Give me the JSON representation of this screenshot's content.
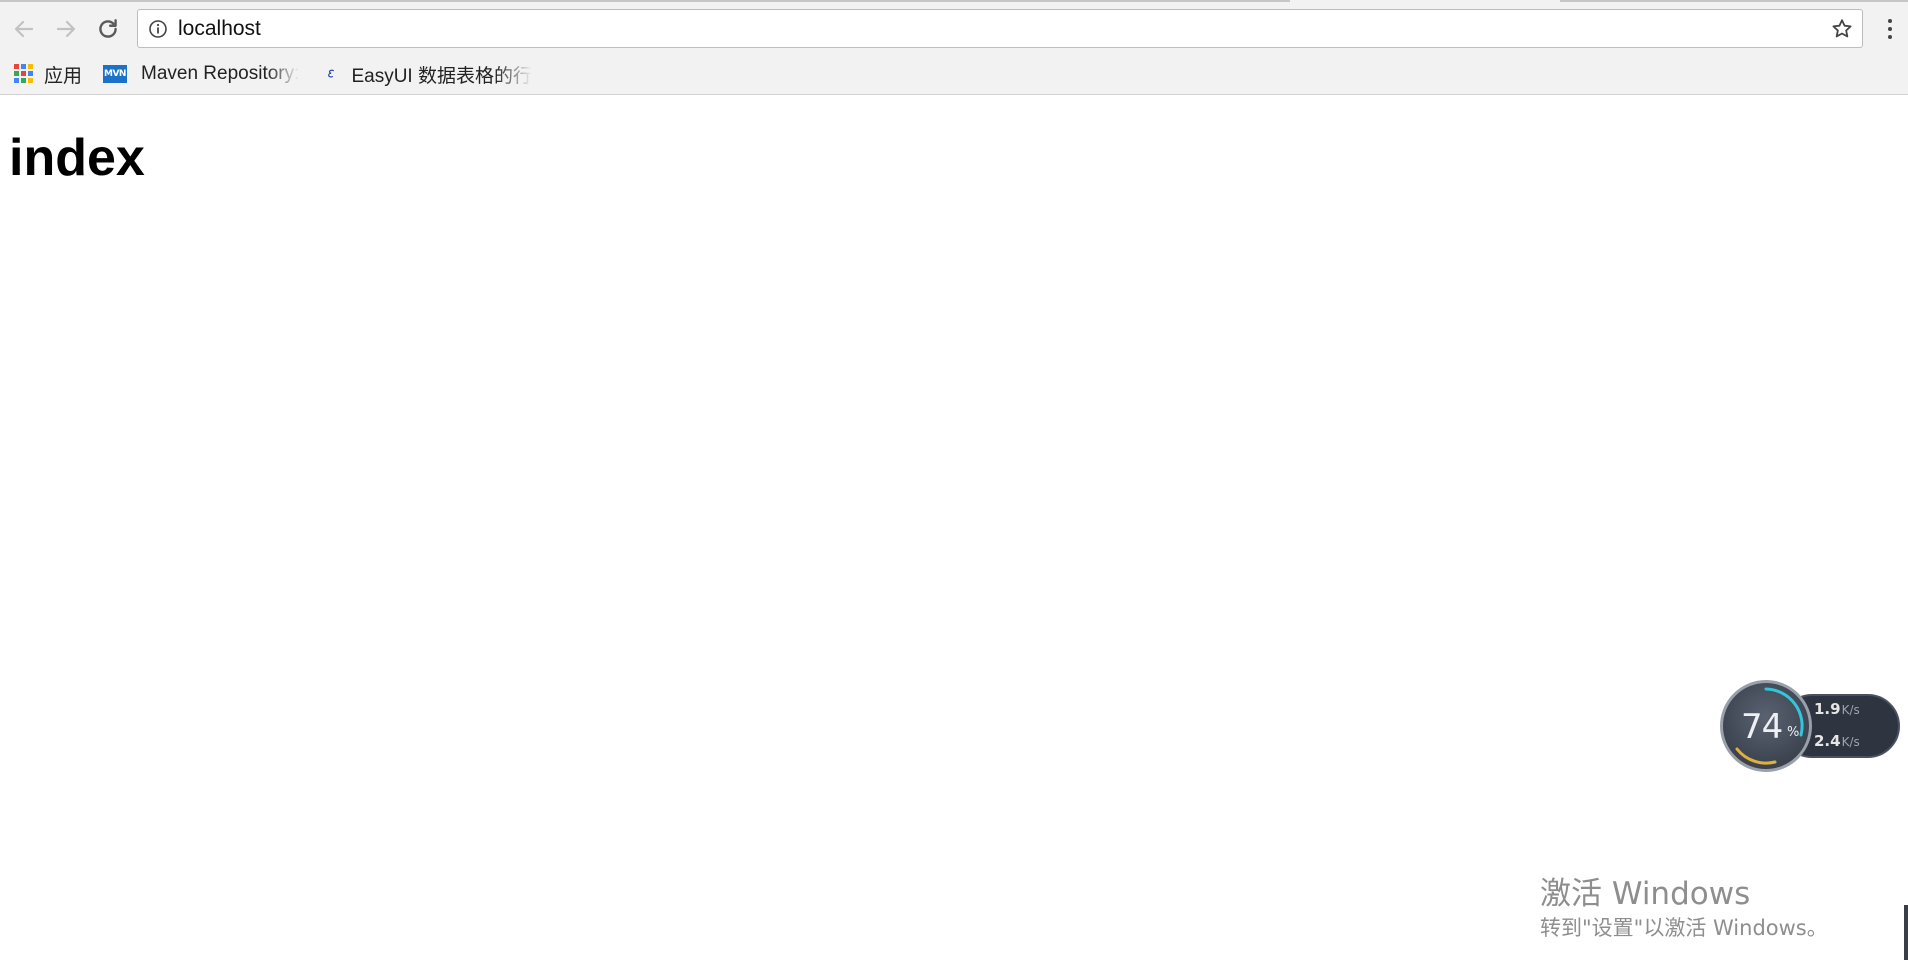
{
  "browser": {
    "address_bar": {
      "url": "localhost",
      "icon": "info-icon"
    },
    "nav": {
      "back_icon": "back-arrow-icon",
      "forward_icon": "forward-arrow-icon",
      "reload_icon": "reload-icon"
    },
    "bookmark_star_icon": "star-icon",
    "menu_icon": "kebab-menu-icon",
    "bookmarks": [
      {
        "label": "应用",
        "icon": "apps-grid-icon"
      },
      {
        "label": "Maven Repository:",
        "icon": "mvn-icon",
        "icon_text": "MVN"
      },
      {
        "label": "EasyUI 数据表格的行",
        "icon": "easyui-logo-icon"
      }
    ]
  },
  "page": {
    "heading": "index"
  },
  "network_widget": {
    "cpu_percent": "74",
    "percent_sign": "%",
    "upload": {
      "value": "1.9",
      "unit": "K/s"
    },
    "download": {
      "value": "2.4",
      "unit": "K/s"
    },
    "colors": {
      "upload_arrow": "#2aa3ff",
      "download_arrow": "#37c24a",
      "ring_cyan": "#32c6d8",
      "ring_yellow": "#e0b13a"
    }
  },
  "watermark": {
    "title": "激活 Windows",
    "subtitle": "转到\"设置\"以激活 Windows。"
  }
}
